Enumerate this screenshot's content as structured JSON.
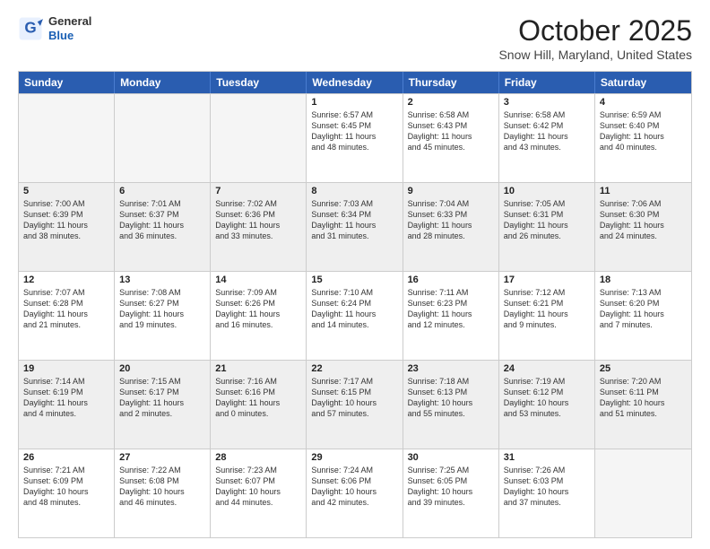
{
  "header": {
    "logo_general": "General",
    "logo_blue": "Blue",
    "month": "October 2025",
    "location": "Snow Hill, Maryland, United States"
  },
  "days_of_week": [
    "Sunday",
    "Monday",
    "Tuesday",
    "Wednesday",
    "Thursday",
    "Friday",
    "Saturday"
  ],
  "weeks": [
    [
      {
        "day": "",
        "info": "",
        "empty": true
      },
      {
        "day": "",
        "info": "",
        "empty": true
      },
      {
        "day": "",
        "info": "",
        "empty": true
      },
      {
        "day": "1",
        "info": "Sunrise: 6:57 AM\nSunset: 6:45 PM\nDaylight: 11 hours\nand 48 minutes."
      },
      {
        "day": "2",
        "info": "Sunrise: 6:58 AM\nSunset: 6:43 PM\nDaylight: 11 hours\nand 45 minutes."
      },
      {
        "day": "3",
        "info": "Sunrise: 6:58 AM\nSunset: 6:42 PM\nDaylight: 11 hours\nand 43 minutes."
      },
      {
        "day": "4",
        "info": "Sunrise: 6:59 AM\nSunset: 6:40 PM\nDaylight: 11 hours\nand 40 minutes."
      }
    ],
    [
      {
        "day": "5",
        "info": "Sunrise: 7:00 AM\nSunset: 6:39 PM\nDaylight: 11 hours\nand 38 minutes.",
        "shaded": true
      },
      {
        "day": "6",
        "info": "Sunrise: 7:01 AM\nSunset: 6:37 PM\nDaylight: 11 hours\nand 36 minutes.",
        "shaded": true
      },
      {
        "day": "7",
        "info": "Sunrise: 7:02 AM\nSunset: 6:36 PM\nDaylight: 11 hours\nand 33 minutes.",
        "shaded": true
      },
      {
        "day": "8",
        "info": "Sunrise: 7:03 AM\nSunset: 6:34 PM\nDaylight: 11 hours\nand 31 minutes.",
        "shaded": true
      },
      {
        "day": "9",
        "info": "Sunrise: 7:04 AM\nSunset: 6:33 PM\nDaylight: 11 hours\nand 28 minutes.",
        "shaded": true
      },
      {
        "day": "10",
        "info": "Sunrise: 7:05 AM\nSunset: 6:31 PM\nDaylight: 11 hours\nand 26 minutes.",
        "shaded": true
      },
      {
        "day": "11",
        "info": "Sunrise: 7:06 AM\nSunset: 6:30 PM\nDaylight: 11 hours\nand 24 minutes.",
        "shaded": true
      }
    ],
    [
      {
        "day": "12",
        "info": "Sunrise: 7:07 AM\nSunset: 6:28 PM\nDaylight: 11 hours\nand 21 minutes."
      },
      {
        "day": "13",
        "info": "Sunrise: 7:08 AM\nSunset: 6:27 PM\nDaylight: 11 hours\nand 19 minutes."
      },
      {
        "day": "14",
        "info": "Sunrise: 7:09 AM\nSunset: 6:26 PM\nDaylight: 11 hours\nand 16 minutes."
      },
      {
        "day": "15",
        "info": "Sunrise: 7:10 AM\nSunset: 6:24 PM\nDaylight: 11 hours\nand 14 minutes."
      },
      {
        "day": "16",
        "info": "Sunrise: 7:11 AM\nSunset: 6:23 PM\nDaylight: 11 hours\nand 12 minutes."
      },
      {
        "day": "17",
        "info": "Sunrise: 7:12 AM\nSunset: 6:21 PM\nDaylight: 11 hours\nand 9 minutes."
      },
      {
        "day": "18",
        "info": "Sunrise: 7:13 AM\nSunset: 6:20 PM\nDaylight: 11 hours\nand 7 minutes."
      }
    ],
    [
      {
        "day": "19",
        "info": "Sunrise: 7:14 AM\nSunset: 6:19 PM\nDaylight: 11 hours\nand 4 minutes.",
        "shaded": true
      },
      {
        "day": "20",
        "info": "Sunrise: 7:15 AM\nSunset: 6:17 PM\nDaylight: 11 hours\nand 2 minutes.",
        "shaded": true
      },
      {
        "day": "21",
        "info": "Sunrise: 7:16 AM\nSunset: 6:16 PM\nDaylight: 11 hours\nand 0 minutes.",
        "shaded": true
      },
      {
        "day": "22",
        "info": "Sunrise: 7:17 AM\nSunset: 6:15 PM\nDaylight: 10 hours\nand 57 minutes.",
        "shaded": true
      },
      {
        "day": "23",
        "info": "Sunrise: 7:18 AM\nSunset: 6:13 PM\nDaylight: 10 hours\nand 55 minutes.",
        "shaded": true
      },
      {
        "day": "24",
        "info": "Sunrise: 7:19 AM\nSunset: 6:12 PM\nDaylight: 10 hours\nand 53 minutes.",
        "shaded": true
      },
      {
        "day": "25",
        "info": "Sunrise: 7:20 AM\nSunset: 6:11 PM\nDaylight: 10 hours\nand 51 minutes.",
        "shaded": true
      }
    ],
    [
      {
        "day": "26",
        "info": "Sunrise: 7:21 AM\nSunset: 6:09 PM\nDaylight: 10 hours\nand 48 minutes."
      },
      {
        "day": "27",
        "info": "Sunrise: 7:22 AM\nSunset: 6:08 PM\nDaylight: 10 hours\nand 46 minutes."
      },
      {
        "day": "28",
        "info": "Sunrise: 7:23 AM\nSunset: 6:07 PM\nDaylight: 10 hours\nand 44 minutes."
      },
      {
        "day": "29",
        "info": "Sunrise: 7:24 AM\nSunset: 6:06 PM\nDaylight: 10 hours\nand 42 minutes."
      },
      {
        "day": "30",
        "info": "Sunrise: 7:25 AM\nSunset: 6:05 PM\nDaylight: 10 hours\nand 39 minutes."
      },
      {
        "day": "31",
        "info": "Sunrise: 7:26 AM\nSunset: 6:03 PM\nDaylight: 10 hours\nand 37 minutes."
      },
      {
        "day": "",
        "info": "",
        "empty": true
      }
    ]
  ]
}
